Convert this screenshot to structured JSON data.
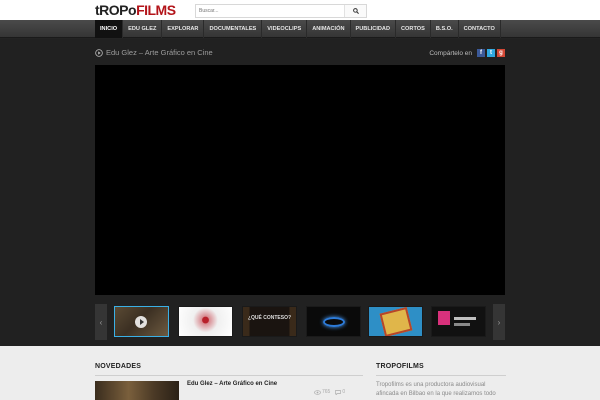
{
  "header": {
    "logo_part1": "tROPo",
    "logo_part2": "FILMS",
    "search_placeholder": "Buscar...",
    "search_button_icon": "search-icon"
  },
  "nav": {
    "items": [
      "INICIO",
      "EDU GLEZ",
      "EXPLORAR",
      "DOCUMENTALES",
      "VIDEOCLIPS",
      "ANIMACIÓN",
      "PUBLICIDAD",
      "CORTOS",
      "B.S.O.",
      "CONTACTO"
    ],
    "active_index": 0
  },
  "video": {
    "title": "Edu Glez – Arte Gráfico en Cine",
    "share_label": "Compártelo en"
  },
  "carousel": {
    "prev_icon": "chevron-left-icon",
    "next_icon": "chevron-right-icon",
    "thumbs": [
      {
        "id": "thumb-1",
        "active": true
      },
      {
        "id": "thumb-2",
        "active": false
      },
      {
        "id": "thumb-3",
        "active": false,
        "text": "¿QUÉ CONTESO?"
      },
      {
        "id": "thumb-4",
        "active": false
      },
      {
        "id": "thumb-5",
        "active": false
      },
      {
        "id": "thumb-6",
        "active": false
      }
    ]
  },
  "novedades": {
    "title": "NOVEDADES",
    "post_title": "Edu Glez – Arte Gráfico en Cine",
    "views": "765",
    "comments": "0"
  },
  "tropofilms": {
    "title": "TROPOFILMS",
    "text": "Tropofilms es una productora audiovisual afincada en Bilbao en la que realizamos todo"
  },
  "colors": {
    "accent_red": "#b3141a",
    "active_thumb_border": "#3ab0e6"
  }
}
